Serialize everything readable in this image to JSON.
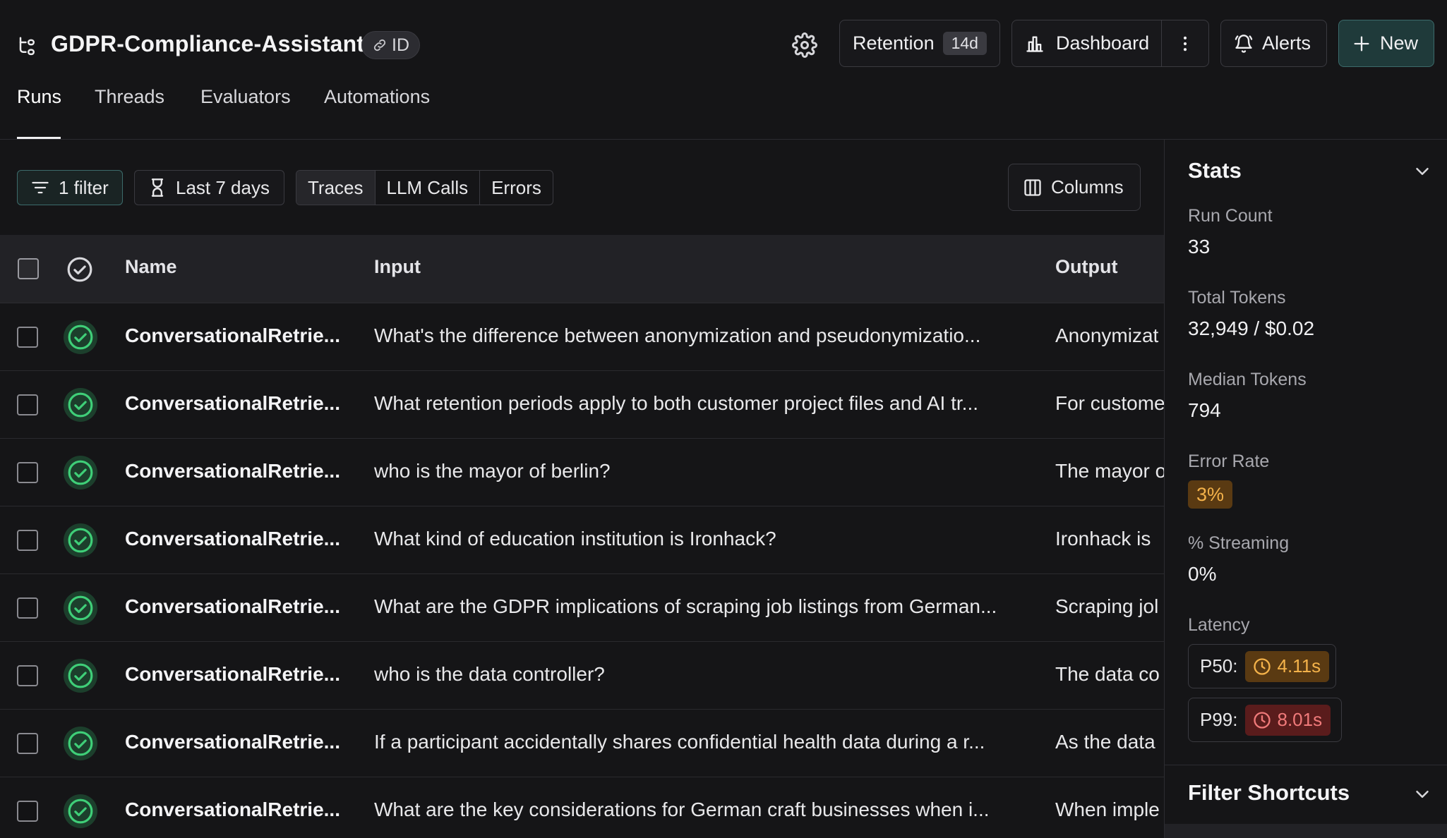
{
  "header": {
    "project_title": "GDPR-Compliance-Assistant",
    "id_chip": "ID",
    "retention_label": "Retention",
    "retention_badge": "14d",
    "dashboard_label": "Dashboard",
    "alerts_label": "Alerts",
    "new_label": "New"
  },
  "tabs": [
    {
      "label": "Runs",
      "active": true
    },
    {
      "label": "Threads",
      "active": false
    },
    {
      "label": "Evaluators",
      "active": false
    },
    {
      "label": "Automations",
      "active": false
    }
  ],
  "toolbar": {
    "filter_label": "1 filter",
    "time_label": "Last 7 days",
    "segments": [
      "Traces",
      "LLM Calls",
      "Errors"
    ],
    "active_segment": "Traces",
    "columns_label": "Columns"
  },
  "table": {
    "columns": {
      "name": "Name",
      "input": "Input",
      "output": "Output"
    },
    "rows": [
      {
        "name": "ConversationalRetrie...",
        "input": "What's the difference between anonymization and pseudonymizatio...",
        "output": "Anonymizat",
        "status": "success"
      },
      {
        "name": "ConversationalRetrie...",
        "input": "What retention periods apply to both customer project files and AI tr...",
        "output": "For custome",
        "status": "success"
      },
      {
        "name": "ConversationalRetrie...",
        "input": "who is the mayor of berlin?",
        "output": "The mayor o",
        "status": "success"
      },
      {
        "name": "ConversationalRetrie...",
        "input": "What kind of education institution is Ironhack?",
        "output": "Ironhack is",
        "status": "success"
      },
      {
        "name": "ConversationalRetrie...",
        "input": "What are the GDPR implications of scraping job listings from German...",
        "output": "Scraping jol",
        "status": "success"
      },
      {
        "name": "ConversationalRetrie...",
        "input": "who is the data controller?",
        "output": "The data co",
        "status": "success"
      },
      {
        "name": "ConversationalRetrie...",
        "input": "If a participant accidentally shares confidential health data during a r...",
        "output": "As the data",
        "status": "success"
      },
      {
        "name": "ConversationalRetrie...",
        "input": "What are the key considerations for German craft businesses when i...",
        "output": "When imple",
        "status": "success"
      }
    ]
  },
  "stats": {
    "title": "Stats",
    "run_count_label": "Run Count",
    "run_count": "33",
    "total_tokens_label": "Total Tokens",
    "total_tokens": "32,949 / $0.02",
    "median_tokens_label": "Median Tokens",
    "median_tokens": "794",
    "error_rate_label": "Error Rate",
    "error_rate": "3%",
    "streaming_label": "% Streaming",
    "streaming": "0%",
    "latency_label": "Latency",
    "p50_label": "P50:",
    "p50": "4.11s",
    "p99_label": "P99:",
    "p99": "8.01s"
  },
  "filter_shortcuts": {
    "title": "Filter Shortcuts"
  },
  "colors": {
    "background": "#151517",
    "accent_teal": "#3c6b6b",
    "success_green": "#3fcf78",
    "warning_amber": "#f4b24a",
    "danger_red": "#f07a7a"
  }
}
